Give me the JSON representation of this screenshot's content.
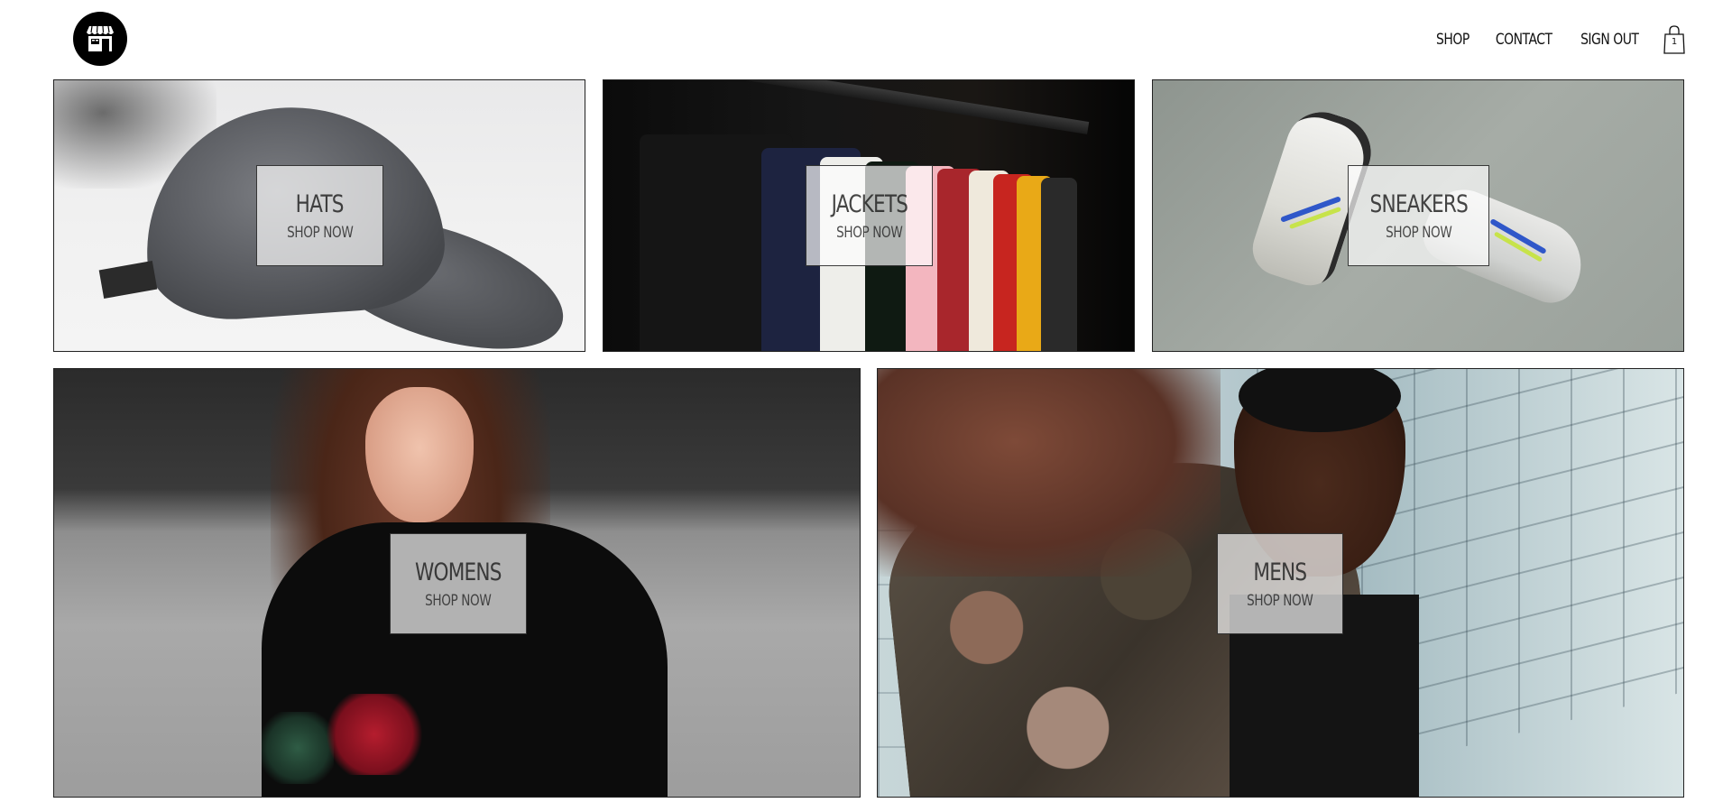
{
  "header": {
    "logo_icon": "storefront-icon",
    "nav": {
      "shop": "SHOP",
      "contact": "CONTACT",
      "sign_out": "SIGN OUT"
    },
    "cart": {
      "icon": "shopping-bag-icon",
      "count": "1"
    }
  },
  "directory": {
    "items": [
      {
        "title": "HATS",
        "subtitle": "SHOP NOW"
      },
      {
        "title": "JACKETS",
        "subtitle": "SHOP NOW"
      },
      {
        "title": "SNEAKERS",
        "subtitle": "SHOP NOW"
      },
      {
        "title": "WOMENS",
        "subtitle": "SHOP NOW"
      },
      {
        "title": "MENS",
        "subtitle": "SHOP NOW"
      }
    ]
  },
  "colors": {
    "text": "#111111",
    "border": "#222222",
    "overlay": "#ffffff"
  }
}
